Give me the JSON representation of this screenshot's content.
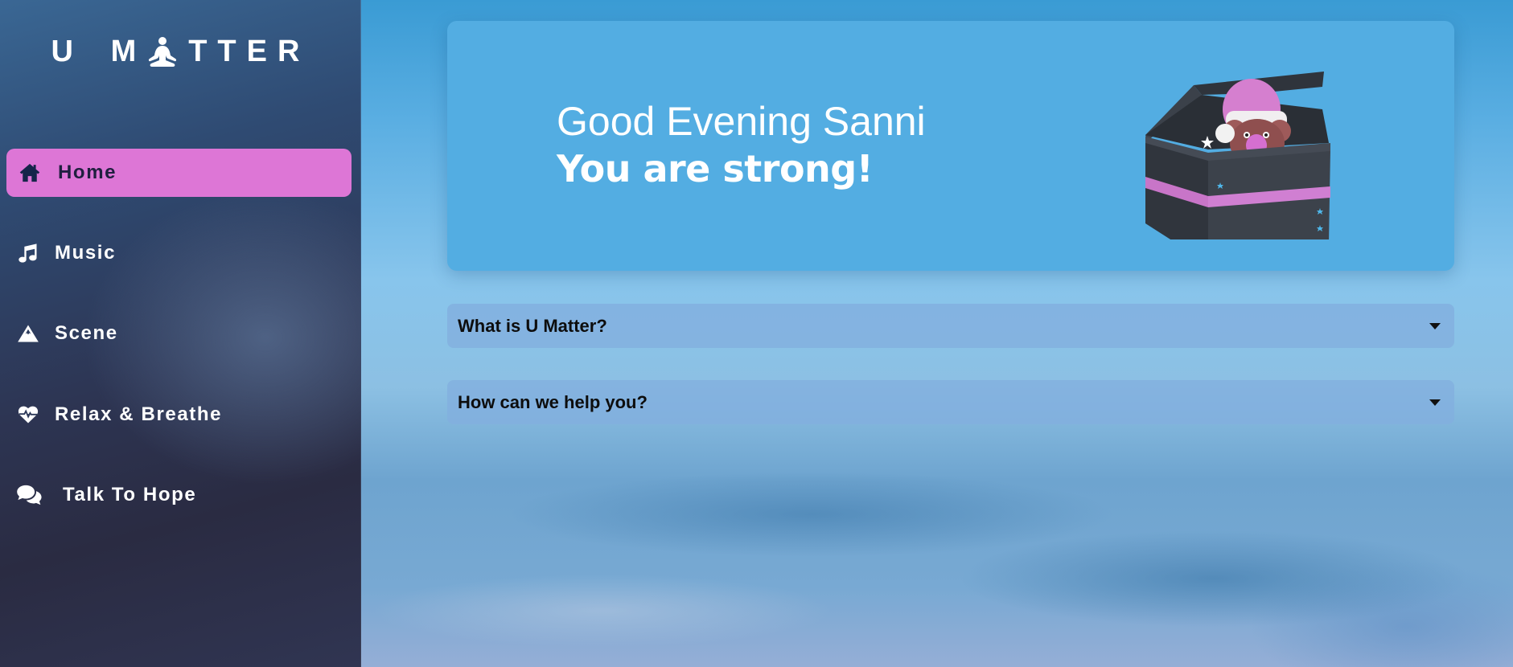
{
  "app": {
    "logo": {
      "left": "U",
      "middle_icon": "meditation-person-icon",
      "right": "TTER",
      "full": "U MATTER"
    },
    "accent_color": "#dd76d6",
    "hero_color": "#53ade2"
  },
  "sidebar": {
    "items": [
      {
        "label": "Home",
        "icon": "home-icon",
        "active": true
      },
      {
        "label": "Music",
        "icon": "music-note-icon",
        "active": false
      },
      {
        "label": "Scene",
        "icon": "mountain-icon",
        "active": false
      },
      {
        "label": "Relax & Breathe",
        "icon": "heartbeat-icon",
        "active": false
      },
      {
        "label": "Talk To Hope",
        "icon": "chat-bubbles-icon",
        "active": false
      }
    ]
  },
  "hero": {
    "greeting": "Good Evening Sanni",
    "tagline": "You are strong!",
    "illustration": "bear-in-gift-box-illustration"
  },
  "faq": [
    {
      "question": "What is U Matter?",
      "icon": "caret-down-icon"
    },
    {
      "question": "How can we help you?",
      "icon": "caret-down-icon"
    }
  ]
}
